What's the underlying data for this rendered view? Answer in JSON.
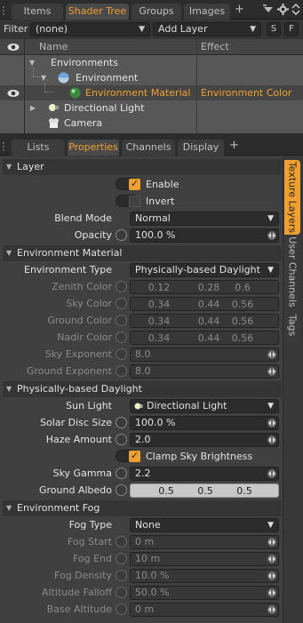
{
  "top_tabs": [
    "Items",
    "Shader Tree",
    "Groups",
    "Images"
  ],
  "top_tab_active": "Shader Tree",
  "plus_label": "+",
  "filter": {
    "label": "Filter",
    "value": "(none)",
    "add_layer": "Add Layer",
    "s_button": "S",
    "f_button": "F"
  },
  "tree": {
    "col_name": "Name",
    "col_effect": "Effect",
    "rows": [
      {
        "name": "Environments",
        "effect": ""
      },
      {
        "name": "Environment",
        "effect": ""
      },
      {
        "name": "Environment Material",
        "effect": "Environment Color"
      },
      {
        "name": "Directional Light",
        "effect": ""
      },
      {
        "name": "Camera",
        "effect": ""
      }
    ]
  },
  "panel_tabs": [
    "Lists",
    "Properties",
    "Channels",
    "Display"
  ],
  "panel_tab_active": "Properties",
  "side_tabs": [
    "Texture Layers",
    "User Channels",
    "Tags"
  ],
  "side_tab_active": "Texture Layers",
  "layer": {
    "title": "Layer",
    "enable": "Enable",
    "invert": "Invert",
    "blend_mode_label": "Blend Mode",
    "blend_mode": "Normal",
    "opacity_label": "Opacity",
    "opacity": "100.0 %"
  },
  "env_material": {
    "title": "Environment Material",
    "env_type_label": "Environment Type",
    "env_type": "Physically-based Daylight",
    "zenith_label": "Zenith Color",
    "zenith": [
      "0.12",
      "0.28",
      "0.6"
    ],
    "sky_label": "Sky Color",
    "sky": [
      "0.34",
      "0.44",
      "0.56"
    ],
    "ground_label": "Ground Color",
    "ground": [
      "0.34",
      "0.44",
      "0.56"
    ],
    "nadir_label": "Nadir Color",
    "nadir": [
      "0.34",
      "0.44",
      "0.56"
    ],
    "sky_exp_label": "Sky Exponent",
    "sky_exp": "8.0",
    "ground_exp_label": "Ground Exponent",
    "ground_exp": "8.0"
  },
  "daylight": {
    "title": "Physically-based Daylight",
    "sun_light_label": "Sun Light",
    "sun_light": "Directional Light",
    "solar_disc_label": "Solar Disc Size",
    "solar_disc": "100.0 %",
    "haze_label": "Haze Amount",
    "haze": "2.0",
    "clamp": "Clamp Sky Brightness",
    "sky_gamma_label": "Sky Gamma",
    "sky_gamma": "2.2",
    "ground_albedo_label": "Ground Albedo",
    "ground_albedo": [
      "0.5",
      "0.5",
      "0.5"
    ]
  },
  "fog": {
    "title": "Environment Fog",
    "fog_type_label": "Fog Type",
    "fog_type": "None",
    "fog_start_label": "Fog Start",
    "fog_start": "0 m",
    "fog_end_label": "Fog End",
    "fog_end": "10 m",
    "fog_density_label": "Fog Density",
    "fog_density": "10.0 %",
    "altitude_falloff_label": "Altitude Falloff",
    "altitude_falloff": "50.0 %",
    "base_altitude_label": "Base Altitude",
    "base_altitude": "0 m"
  },
  "colors": {
    "accent": "#f0a030",
    "panel": "#404040",
    "tree_bg": "#575757"
  }
}
